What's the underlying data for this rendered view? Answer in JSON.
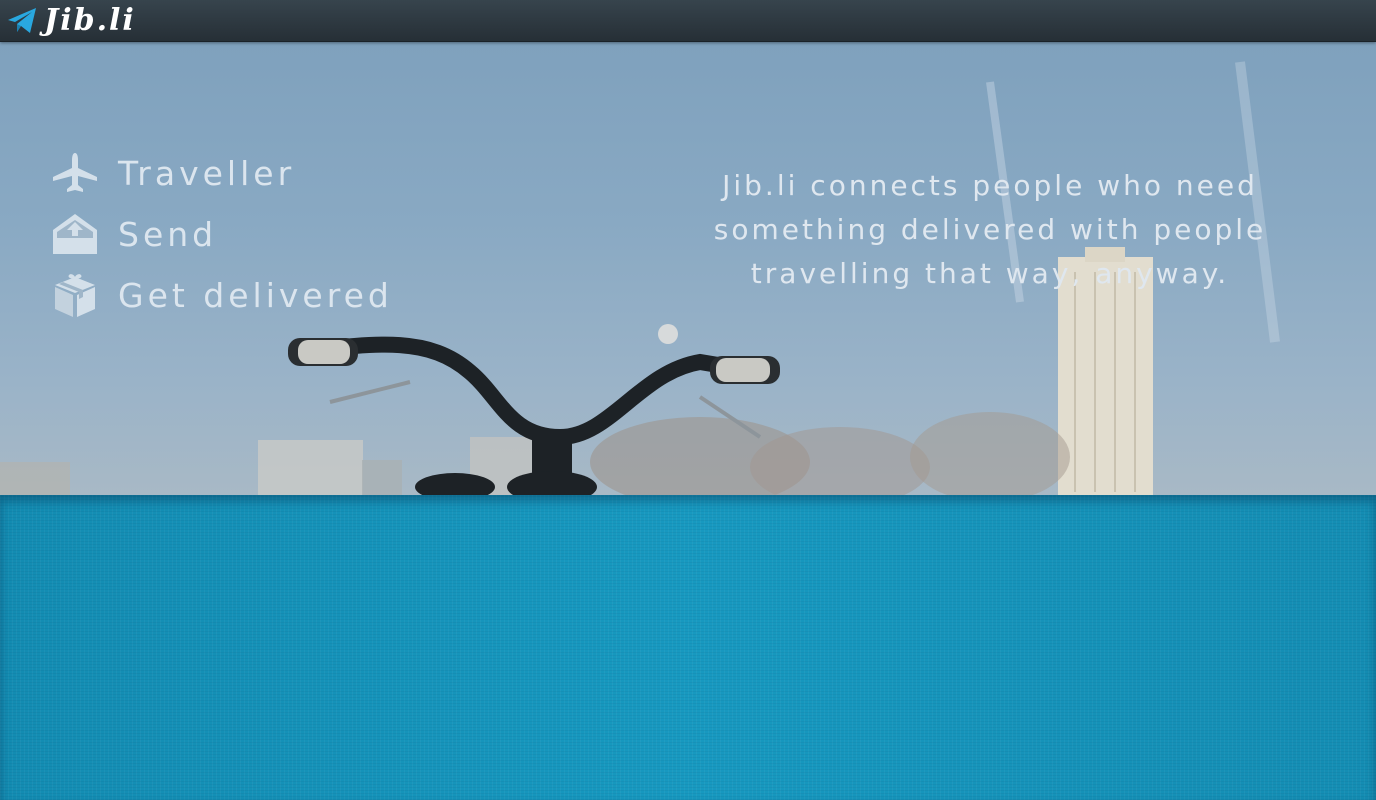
{
  "app": {
    "logo_text": "Jib.li",
    "logo_icon": "paper-plane-icon"
  },
  "nav": {
    "items": [
      {
        "label": "Traveller",
        "icon": "airplane-icon"
      },
      {
        "label": "Send",
        "icon": "outbox-icon"
      },
      {
        "label": "Get delivered",
        "icon": "gift-box-icon"
      }
    ]
  },
  "hero": {
    "tagline": "Jib.li connects people who need something delivered with people travelling that way, anyway."
  },
  "colors": {
    "topbar": "#2f3a42",
    "accent_blue": "#1592b8",
    "logo_icon": "#29a8e0",
    "nav_text": "#dbe5ee"
  }
}
